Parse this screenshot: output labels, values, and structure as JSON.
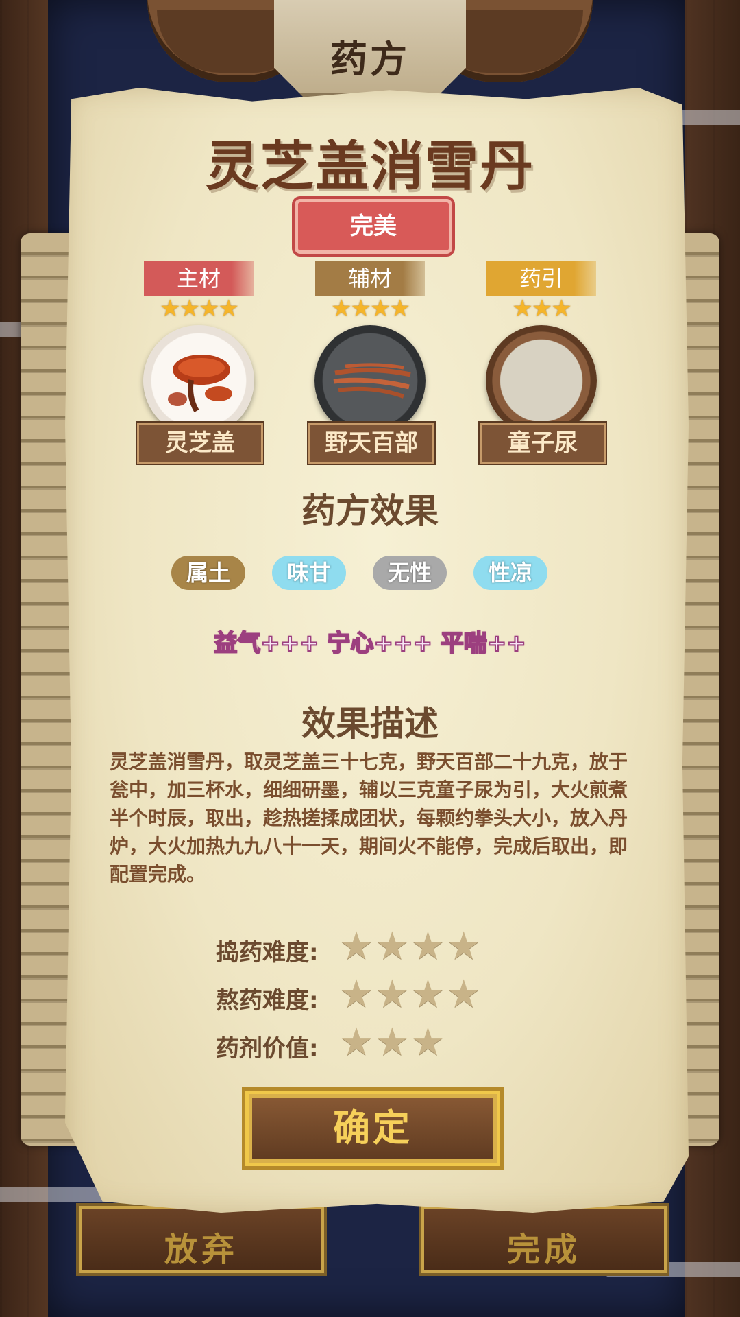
{
  "header": {
    "title": "药方"
  },
  "recipe": {
    "name": "灵芝盖消雪丹",
    "quality": "完美"
  },
  "ingredients": [
    {
      "role": "主材",
      "stars": "★★★★",
      "name": "灵芝盖",
      "role_color": "#d35a59",
      "icon": "lingzhi-mushroom-icon"
    },
    {
      "role": "辅材",
      "stars": "★★★★",
      "name": "野天百部",
      "role_color": "#a37c45",
      "icon": "root-herb-icon"
    },
    {
      "role": "药引",
      "stars": "★★★",
      "name": "童子尿",
      "role_color": "#e0a632",
      "icon": "liquid-bowl-icon"
    }
  ],
  "effects": {
    "heading": "药方效果",
    "tags": [
      {
        "label": "属土",
        "color": "#a88548"
      },
      {
        "label": "味甘",
        "color": "#8fdcef"
      },
      {
        "label": "无性",
        "color": "#a9a9a9"
      },
      {
        "label": "性凉",
        "color": "#8fdcef"
      }
    ],
    "line": "益气+++ 宁心+++ 平喘++"
  },
  "description": {
    "heading": "效果描述",
    "text": "灵芝盖消雪丹，取灵芝盖三十七克，野天百部二十九克，放于瓮中，加三杯水，细细研墨，辅以三克童子尿为引，大火煎煮半个时辰，取出，趁热搓揉成团状，每颗约拳头大小，放入丹炉，大火加热九九八十一天，期间火不能停，完成后取出，即配置完成。"
  },
  "ratings": [
    {
      "label": "捣药难度:",
      "stars": 4,
      "stars_text": "★★★★"
    },
    {
      "label": "熬药难度:",
      "stars": 4,
      "stars_text": "★★★★"
    },
    {
      "label": "药剂价值:",
      "stars": 3,
      "stars_text": "★★★"
    }
  ],
  "buttons": {
    "confirm": "确定",
    "abandon": "放弃",
    "complete": "完成"
  }
}
